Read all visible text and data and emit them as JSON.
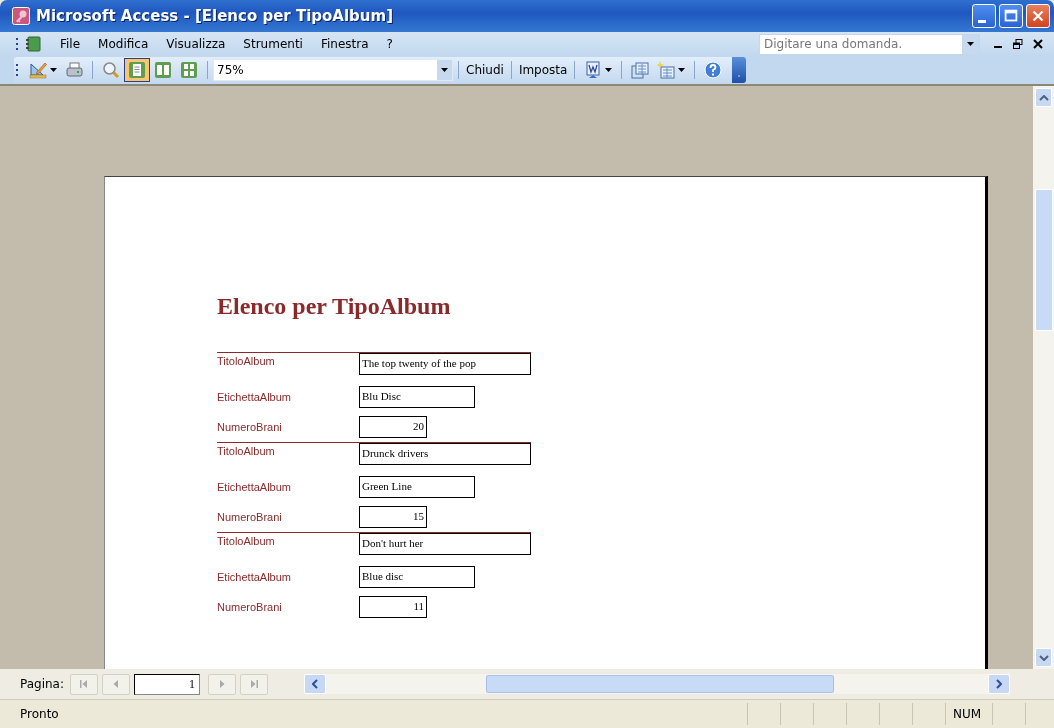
{
  "window": {
    "title": "Microsoft Access - [Elenco per TipoAlbum]"
  },
  "menu": [
    {
      "label": "File"
    },
    {
      "label": "Modifica"
    },
    {
      "label": "Visualizza"
    },
    {
      "label": "Strumenti"
    },
    {
      "label": "Finestra"
    },
    {
      "label": "?"
    }
  ],
  "help_search": {
    "placeholder": "Digitare una domanda."
  },
  "toolbar": [
    {
      "kind": "design",
      "dropdown": true,
      "selected": false
    },
    {
      "kind": "print",
      "selected": false
    },
    {
      "kind": "sep"
    },
    {
      "kind": "zoom",
      "selected": false
    },
    {
      "kind": "one-page",
      "selected": true
    },
    {
      "kind": "two-pages",
      "selected": false
    },
    {
      "kind": "multi-pages",
      "selected": false
    },
    {
      "kind": "sep"
    },
    {
      "kind": "combo",
      "value": "75%"
    },
    {
      "kind": "sep"
    },
    {
      "kind": "text",
      "label": "Chiudi"
    },
    {
      "kind": "sep"
    },
    {
      "kind": "text",
      "label": "Imposta"
    },
    {
      "kind": "sep"
    },
    {
      "kind": "word",
      "dropdown": true,
      "selected": false
    },
    {
      "kind": "sep"
    },
    {
      "kind": "database",
      "selected": false
    },
    {
      "kind": "new-object",
      "dropdown": true,
      "selected": false
    },
    {
      "kind": "sep"
    },
    {
      "kind": "help",
      "selected": false
    }
  ],
  "report": {
    "title": "Elenco per TipoAlbum",
    "records": [
      {
        "fields": [
          {
            "label": "TitoloAlbum",
            "value": "The top twenty of the pop",
            "kind": "title"
          },
          {
            "label": "EtichettaAlbum",
            "value": "Blu Disc",
            "kind": "label"
          },
          {
            "label": "NumeroBrani",
            "value": "20",
            "kind": "count"
          }
        ]
      },
      {
        "fields": [
          {
            "label": "TitoloAlbum",
            "value": "Drunck drivers",
            "kind": "title"
          },
          {
            "label": "EtichettaAlbum",
            "value": "Green Line",
            "kind": "label"
          },
          {
            "label": "NumeroBrani",
            "value": "15",
            "kind": "count"
          }
        ]
      },
      {
        "fields": [
          {
            "label": "TitoloAlbum",
            "value": "Don't hurt her",
            "kind": "title"
          },
          {
            "label": "EtichettaAlbum",
            "value": "Blue disc",
            "kind": "label"
          },
          {
            "label": "NumeroBrani",
            "value": "11",
            "kind": "count"
          }
        ]
      }
    ]
  },
  "navigation": {
    "label": "Pagina:",
    "page": "1"
  },
  "status_bar": {
    "text": "Pronto",
    "indicators": [
      "NUM"
    ]
  }
}
